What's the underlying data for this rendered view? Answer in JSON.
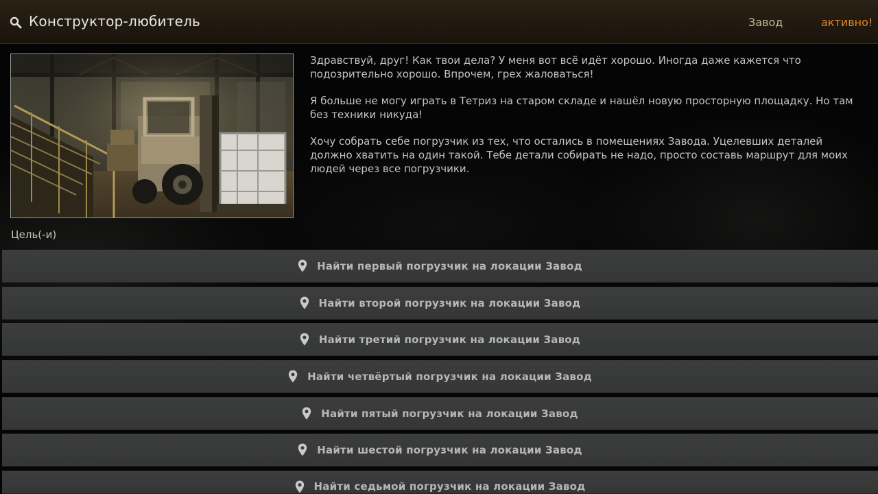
{
  "header": {
    "title": "Конструктор-любитель",
    "location": "Завод",
    "status": "активно!",
    "search_icon": "search-icon"
  },
  "description": {
    "paragraphs": [
      "Здравствуй, друг! Как твои дела? У меня вот всё идёт хорошо. Иногда даже кажется что подозрительно хорошо. Впрочем, грех жаловаться!",
      "Я больше не могу играть в Тетриз на старом складе и нашёл новую просторную площадку. Но там без техники никуда!",
      "Хочу собрать себе погрузчик из тех, что остались в помещениях Завода. Уцелевших деталей должно хватить на один такой. Тебе детали собирать не надо, просто составь маршрут для моих людей через все погрузчики."
    ]
  },
  "objectives": {
    "label": "Цель(-и)",
    "icon": "map-pin-icon",
    "items": [
      "Найти первый погрузчик на локации Завод",
      "Найти второй погрузчик на локации Завод",
      "Найти третий погрузчик на локации Завод",
      "Найти четвёртый погрузчик на локации Завод",
      "Найти пятый погрузчик на локации Завод",
      "Найти шестой погрузчик на локации Завод",
      "Найти седьмой погрузчик на локации Завод"
    ]
  },
  "colors": {
    "header_bg": "#221a10",
    "status": "#e8852c",
    "location": "#c8b89a",
    "objective_bg": "#3a3b3b",
    "text": "#c4c4c4"
  }
}
